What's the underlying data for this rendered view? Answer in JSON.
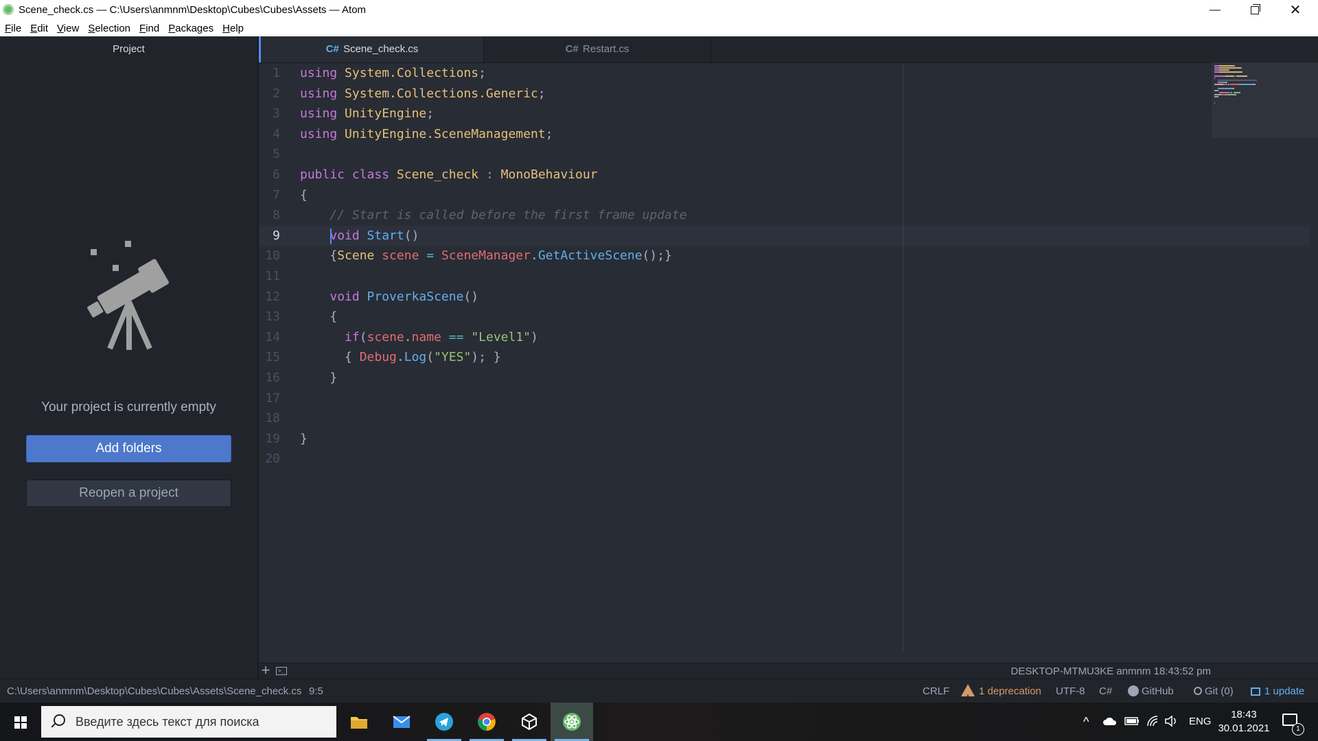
{
  "window": {
    "title": "Scene_check.cs — C:\\Users\\anmnm\\Desktop\\Cubes\\Cubes\\Assets — Atom",
    "minimize": "—",
    "close": "✕"
  },
  "menu": [
    "File",
    "Edit",
    "View",
    "Selection",
    "Find",
    "Packages",
    "Help"
  ],
  "sidebar": {
    "title": "Project",
    "empty_message": "Your project is currently empty",
    "add_folders": "Add folders",
    "reopen_project": "Reopen a project"
  },
  "tabs": [
    {
      "prefix": "C#",
      "label": "Scene_check.cs",
      "active": true
    },
    {
      "prefix": "C#",
      "label": "Restart.cs",
      "active": false
    }
  ],
  "editor": {
    "cursor_line": 9,
    "lines": [
      [
        {
          "c": "k",
          "t": "using "
        },
        {
          "c": "t",
          "t": "System.Collections"
        },
        {
          "c": "",
          "t": ";"
        }
      ],
      [
        {
          "c": "k",
          "t": "using "
        },
        {
          "c": "t",
          "t": "System.Collections.Generic"
        },
        {
          "c": "",
          "t": ";"
        }
      ],
      [
        {
          "c": "k",
          "t": "using "
        },
        {
          "c": "t",
          "t": "UnityEngine"
        },
        {
          "c": "",
          "t": ";"
        }
      ],
      [
        {
          "c": "k",
          "t": "using "
        },
        {
          "c": "t",
          "t": "UnityEngine.SceneManagement"
        },
        {
          "c": "",
          "t": ";"
        }
      ],
      [],
      [
        {
          "c": "k",
          "t": "public class "
        },
        {
          "c": "t",
          "t": "Scene_check"
        },
        {
          "c": "",
          "t": " "
        },
        {
          "c": "o",
          "t": ":"
        },
        {
          "c": "",
          "t": " "
        },
        {
          "c": "t",
          "t": "MonoBehaviour"
        }
      ],
      [
        {
          "c": "",
          "t": "{"
        }
      ],
      [
        {
          "c": "",
          "t": "    "
        },
        {
          "c": "c",
          "t": "// Start is called before the first frame update"
        }
      ],
      [
        {
          "c": "",
          "t": "    "
        },
        {
          "c": "k",
          "t": "void "
        },
        {
          "c": "f",
          "t": "Start"
        },
        {
          "c": "",
          "t": "()"
        }
      ],
      [
        {
          "c": "",
          "t": "    {"
        },
        {
          "c": "t",
          "t": "Scene "
        },
        {
          "c": "v",
          "t": "scene"
        },
        {
          "c": "",
          "t": " "
        },
        {
          "c": "o",
          "t": "="
        },
        {
          "c": "",
          "t": " "
        },
        {
          "c": "v",
          "t": "SceneManager"
        },
        {
          "c": "",
          "t": "."
        },
        {
          "c": "f",
          "t": "GetActiveScene"
        },
        {
          "c": "",
          "t": "();}"
        }
      ],
      [],
      [
        {
          "c": "",
          "t": "    "
        },
        {
          "c": "k",
          "t": "void "
        },
        {
          "c": "f",
          "t": "ProverkaScene"
        },
        {
          "c": "",
          "t": "()"
        }
      ],
      [
        {
          "c": "",
          "t": "    {"
        }
      ],
      [
        {
          "c": "",
          "t": "      "
        },
        {
          "c": "k",
          "t": "if"
        },
        {
          "c": "",
          "t": "("
        },
        {
          "c": "v",
          "t": "scene"
        },
        {
          "c": "",
          "t": "."
        },
        {
          "c": "v",
          "t": "name"
        },
        {
          "c": "",
          "t": " "
        },
        {
          "c": "o",
          "t": "=="
        },
        {
          "c": "",
          "t": " "
        },
        {
          "c": "s",
          "t": "\"Level1\""
        },
        {
          "c": "",
          "t": ")"
        }
      ],
      [
        {
          "c": "",
          "t": "      { "
        },
        {
          "c": "v",
          "t": "Debug"
        },
        {
          "c": "",
          "t": "."
        },
        {
          "c": "f",
          "t": "Log"
        },
        {
          "c": "",
          "t": "("
        },
        {
          "c": "s",
          "t": "\"YES\""
        },
        {
          "c": "",
          "t": "); }"
        }
      ],
      [
        {
          "c": "",
          "t": "    }"
        }
      ],
      [],
      [],
      [
        {
          "c": "",
          "t": "}"
        }
      ],
      []
    ]
  },
  "editor_bottom": {
    "plus": "+",
    "terminal": ">_",
    "meta": "DESKTOP-MTMU3KE anmnm 18:43:52 pm"
  },
  "status": {
    "path": "C:\\Users\\anmnm\\Desktop\\Cubes\\Cubes\\Assets\\Scene_check.cs",
    "position": "9:5",
    "line_ending": "CRLF",
    "deprecation": "1 deprecation",
    "encoding": "UTF-8",
    "grammar": "C#",
    "github": "GitHub",
    "git": "Git (0)",
    "update": "1 update"
  },
  "taskbar": {
    "search_placeholder": "Введите здесь текст для поиска",
    "language": "ENG",
    "time": "18:43",
    "date": "30.01.2021",
    "notifications": "1"
  },
  "colors": {
    "accent": "#568af2",
    "button_primary": "#4d78cc",
    "keyword": "#c678dd",
    "type": "#e5c07b",
    "function": "#61afef",
    "variable": "#e06c75",
    "string": "#98c379",
    "comment": "#5c6370"
  }
}
